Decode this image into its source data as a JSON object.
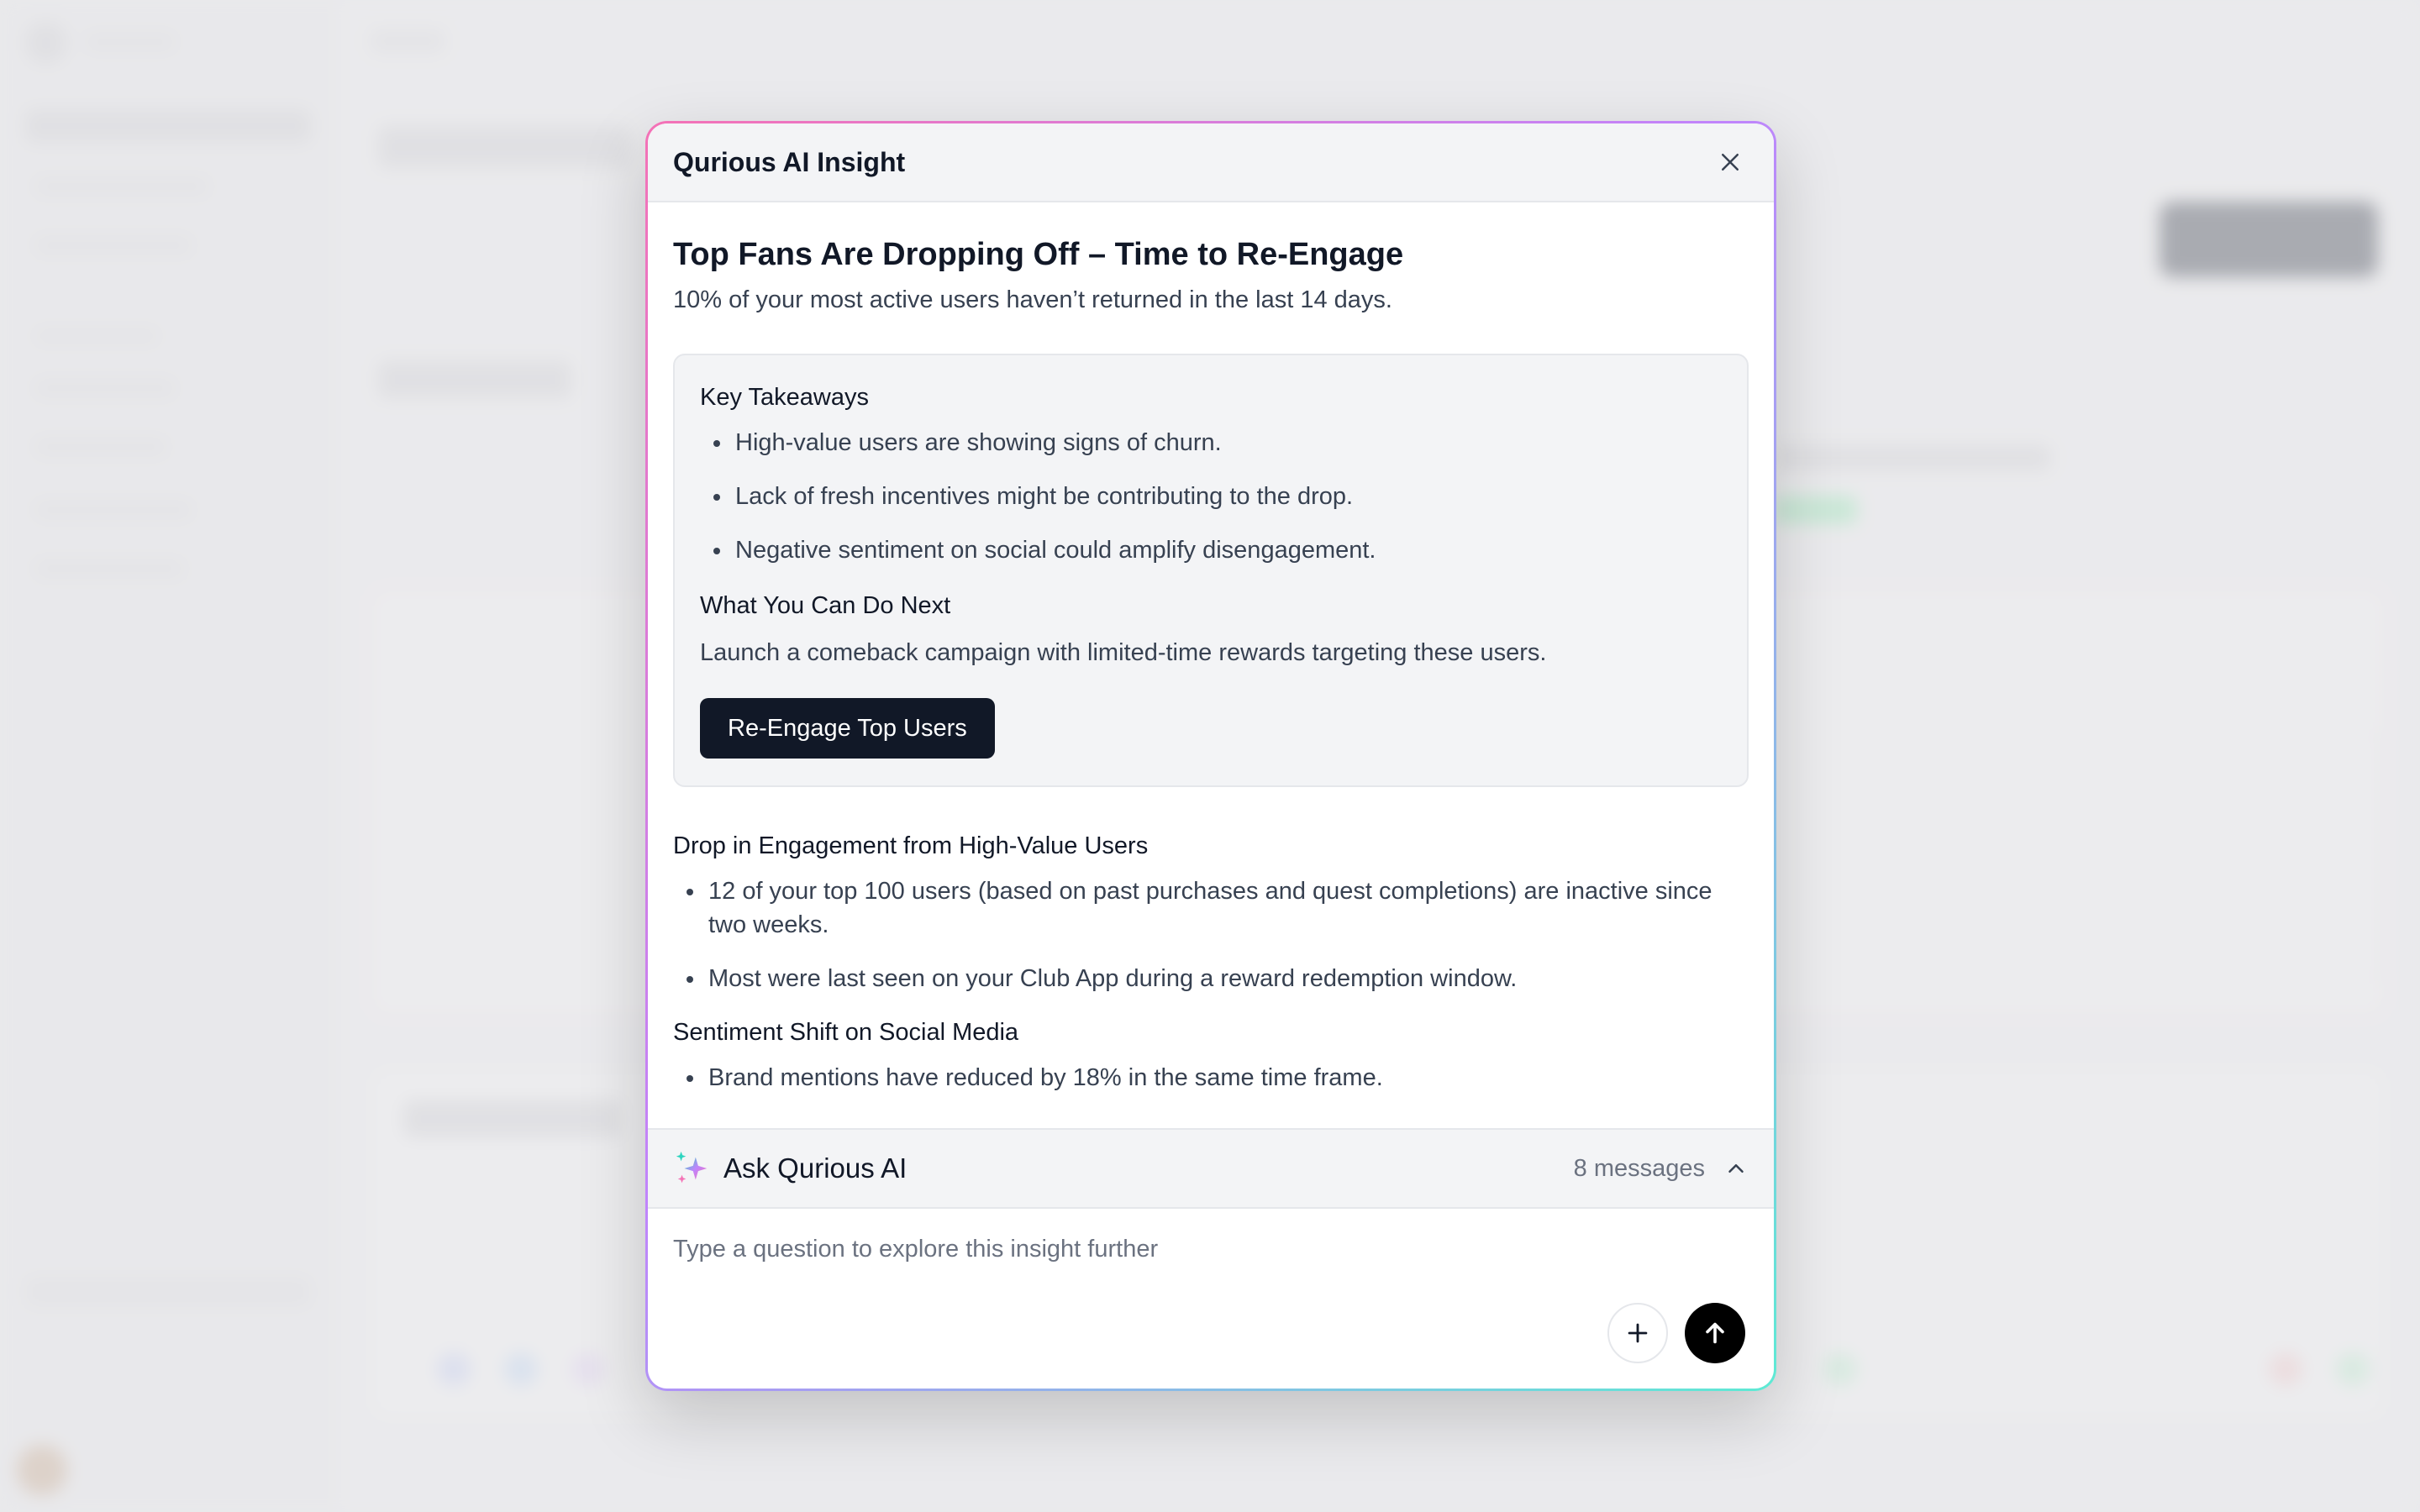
{
  "modal": {
    "title": "Qurious AI Insight",
    "headline": "Top Fans Are Dropping Off – Time to Re-Engage",
    "subheadline": "10% of your most active users haven’t returned in the last 14 days.",
    "key_takeaways": {
      "heading": "Key Takeaways",
      "items": [
        "High-value users are showing signs of churn.",
        "Lack of fresh incentives might be contributing to the drop.",
        "Negative sentiment on social could amplify disengagement."
      ]
    },
    "next_steps": {
      "heading": "What You Can Do Next",
      "text": "Launch a comeback campaign with limited-time rewards targeting these users.",
      "button_label": "Re-Engage Top Users"
    },
    "sections": [
      {
        "heading": "Drop in Engagement from High-Value Users",
        "items": [
          "12 of your top 100 users (based on past purchases and quest completions) are inactive since two weeks.",
          "Most were last seen on your Club App during a reward redemption window."
        ]
      },
      {
        "heading": "Sentiment Shift on Social Media",
        "items": [
          "Brand mentions have reduced by 18% in the same time frame."
        ]
      }
    ],
    "ask": {
      "title": "Ask Qurious AI",
      "message_count": "8 messages",
      "input_placeholder": "Type a question to explore this insight further",
      "input_value": ""
    }
  },
  "icons": {
    "close": "close-icon",
    "sparkles": "sparkles-icon",
    "chevron": "chevron-up-icon",
    "attach": "plus-icon",
    "send": "arrow-up-icon"
  },
  "colors": {
    "primary_button": "#111827",
    "border_gradient": [
      "#f472b6",
      "#c084fc",
      "#5eead4"
    ],
    "send_button": "#000000"
  }
}
